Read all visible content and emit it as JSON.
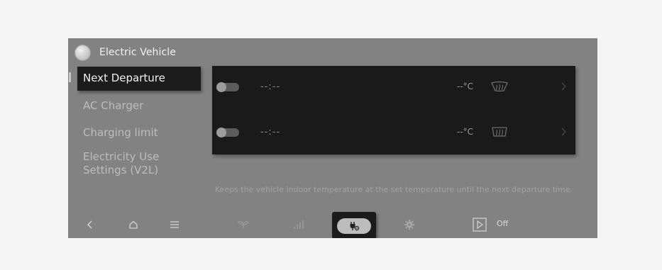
{
  "header": {
    "title": "Electric Vehicle"
  },
  "sidebar": {
    "items": [
      {
        "label": "Next Departure",
        "active": true
      },
      {
        "label": "AC Charger",
        "active": false
      },
      {
        "label": "Charging limit",
        "active": false
      },
      {
        "label": "Electricity Use Settings (V2L)",
        "active": false
      }
    ]
  },
  "departures": [
    {
      "time": "--:--",
      "temperature": "--°C",
      "enabled": false
    },
    {
      "time": "--:--",
      "temperature": "--°C",
      "enabled": false
    }
  ],
  "info": {
    "text": "Keeps the vehicle indoor temperature at the set temperature until the next departure time."
  },
  "bottom_bar": {
    "items": [
      "back-icon",
      "home-icon",
      "menu-icon",
      "eco-leaf-icon",
      "energy-chart-icon",
      "ev-charge-icon",
      "settings-gear-icon",
      "play-icon"
    ],
    "off_label": "Off"
  },
  "colors": {
    "screen_bg": "#828282",
    "panel_bg": "#1a1a1a",
    "active_bg": "#1c1c1c",
    "text_light": "#f2f2f2",
    "text_muted": "#bdbdbd"
  }
}
